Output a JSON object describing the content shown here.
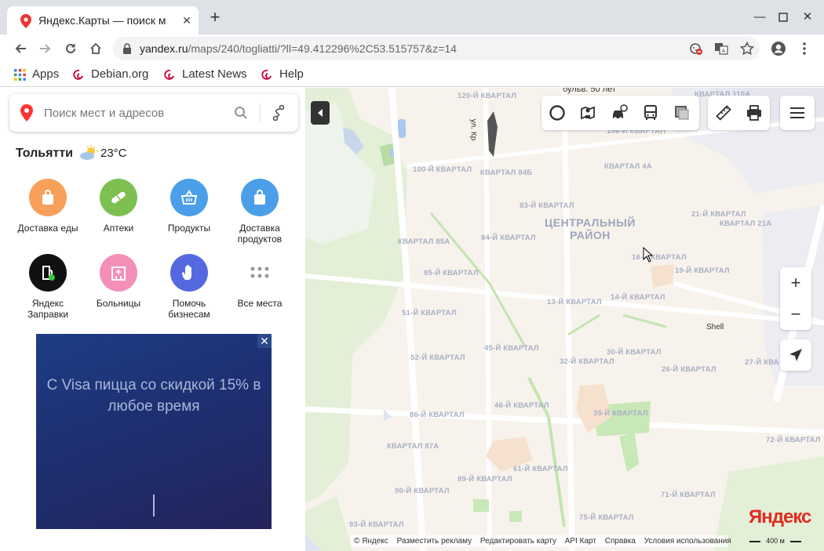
{
  "browser": {
    "tab_title": "Яндекс.Карты — поиск м",
    "url_host": "yandex.ru",
    "url_path": "/maps/240/togliatti/?ll=49.412296%2C53.515757&z=14",
    "bookmarks": [
      "Apps",
      "Debian.org",
      "Latest News",
      "Help"
    ]
  },
  "sidebar": {
    "search_placeholder": "Поиск мест и адресов",
    "city": "Тольятти",
    "temperature": "23°C",
    "categories": [
      {
        "label": "Доставка еды",
        "icon": "shopping-bag-icon",
        "color": "#f7a05a"
      },
      {
        "label": "Аптеки",
        "icon": "pill-icon",
        "color": "#7dbf50"
      },
      {
        "label": "Продукты",
        "icon": "basket-icon",
        "color": "#4a9fe8"
      },
      {
        "label": "Доставка продуктов",
        "icon": "shopping-bag-icon",
        "color": "#4a9fe8"
      },
      {
        "label": "Яндекс Заправки",
        "icon": "fuel-icon",
        "color": "#111111"
      },
      {
        "label": "Больницы",
        "icon": "hospital-icon",
        "color": "#f48fb8"
      },
      {
        "label": "Помочь бизнесам",
        "icon": "hand-icon",
        "color": "#5468e0"
      },
      {
        "label": "Все места",
        "icon": "grid-icon",
        "color": "#ffffff"
      }
    ],
    "ad_text": "С Visa пицца со скидкой 15% в любое время"
  },
  "map": {
    "district": "ЦЕНТРАЛЬНЫЙ РАЙОН",
    "street_top": "бульв. 50 лет",
    "street_vertical": "ул. Кр",
    "poi_shell": "Shell",
    "quarters": [
      "120-Й КВАРТАЛ",
      "КВАРТАЛ 110А",
      "106-Й КВАРТАЛ",
      "100-Й КВАРТАЛ",
      "КВАРТАЛ 84Б",
      "КВАРТАЛ 4А",
      "83-Й КВАРТАЛ",
      "21-Й КВАРТАЛ",
      "КВАРТАЛ 21А",
      "КВАРТАЛ 85А",
      "84-Й КВАРТАЛ",
      "16-Й КВАРТАЛ",
      "19-Й КВАРТАЛ",
      "85-Й КВАРТАЛ",
      "13-Й КВАРТАЛ",
      "14-Й КВАРТАЛ",
      "51-Й КВАРТАЛ",
      "45-Й КВАРТАЛ",
      "30-Й КВАРТАЛ",
      "52-Й КВАРТАЛ",
      "32-Й КВАРТАЛ",
      "26-Й КВАРТАЛ",
      "27-Й КВА",
      "46-Й КВАРТАЛ",
      "86-Й КВАРТАЛ",
      "35-Й КВАРТАЛ",
      "КВАРТАЛ 87А",
      "72-Й КВАРТАЛ",
      "61-Й КВАРТАЛ",
      "89-Й КВАРТАЛ",
      "90-Й КВАРТАЛ",
      "71-Й КВАРТАЛ",
      "75-Й КВАРТАЛ",
      "93-Й КВАРТАЛ"
    ],
    "logo": "Яндекс",
    "footer_links": [
      "© Яндекс",
      "Разместить рекламу",
      "Редактировать карту",
      "API Карт",
      "Справка",
      "Условия использования"
    ],
    "scale": "400 м",
    "zoom_in": "+",
    "zoom_out": "−"
  }
}
